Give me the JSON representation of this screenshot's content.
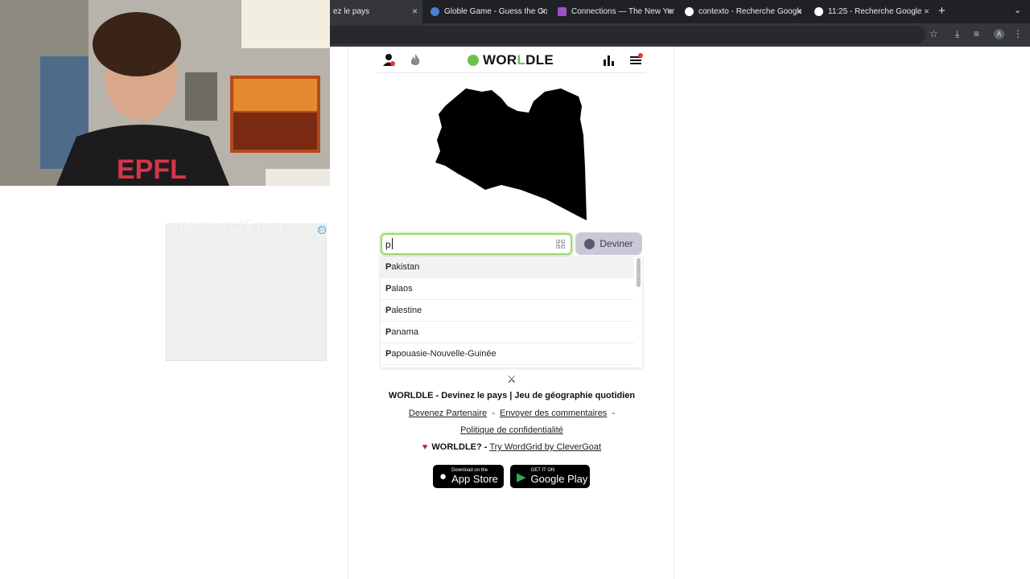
{
  "browser": {
    "tabs": [
      {
        "title": "ez le pays",
        "active": true
      },
      {
        "title": "Globle Game - Guess the Co",
        "active": false
      },
      {
        "title": "Connections — The New York",
        "active": false
      },
      {
        "title": "contexto - Recherche Google",
        "active": false
      },
      {
        "title": "11:25 - Recherche Google",
        "active": false
      }
    ],
    "new_tab": "+",
    "close_glyph": "×",
    "profile_initial": "A"
  },
  "webcam": {
    "shirt_text": "EPFL"
  },
  "ad": {
    "text": "ontexto in 15 min"
  },
  "header": {
    "logo_prefix": "WOR",
    "logo_accent": "L",
    "logo_suffix": "DLE"
  },
  "search": {
    "value": "p",
    "guess_label": "Deviner"
  },
  "suggestions": [
    {
      "bold": "P",
      "rest": "akistan"
    },
    {
      "bold": "P",
      "rest": "alaos"
    },
    {
      "bold": "P",
      "rest": "alestine"
    },
    {
      "bold": "P",
      "rest": "anama"
    },
    {
      "bold": "P",
      "rest": "apouasie-Nouvelle-Guinée"
    }
  ],
  "footer": {
    "title": "WORLDLE - Devinez le pays | Jeu de géographie quotidien",
    "link_partner": "Devenez Partenaire",
    "sep": "-",
    "link_feedback": "Envoyer des commentaires",
    "link_privacy": "Politique de confidentialité",
    "promo_prefix": "WORLDLE? -",
    "promo_link": "Try WordGrid by CleverGoat"
  },
  "stores": {
    "apple_small": "Download on the",
    "apple_big": "App Store",
    "google_small": "GET IT ON",
    "google_big": "Google Play"
  },
  "colors": {
    "accent_green": "#6cc24a",
    "focus_border": "#9ad86e",
    "guess_bg": "#c9c9d6"
  }
}
